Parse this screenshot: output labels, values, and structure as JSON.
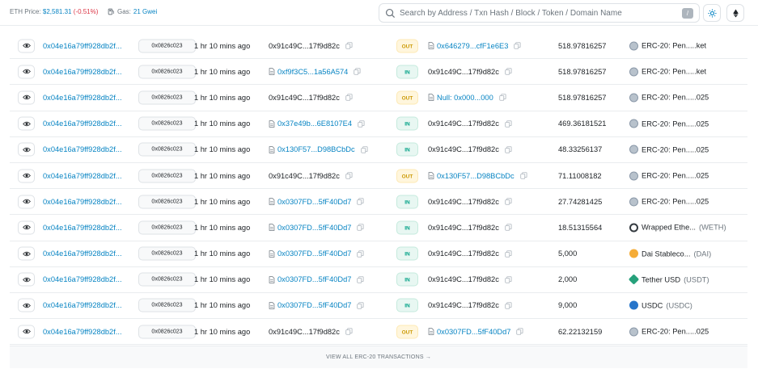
{
  "header": {
    "eth_price_label": "ETH Price: ",
    "eth_price_value": "$2,581.31",
    "eth_price_change": "(-0.51%)",
    "gas_label": "Gas: ",
    "gas_value": "21 Gwei",
    "search_placeholder": "Search by Address / Txn Hash / Block / Token / Domain Name",
    "search_shortcut": "/",
    "colors": {
      "link": "#0784c3",
      "negative": "#dc3545",
      "out": "#cc9a06",
      "in": "#00a186"
    }
  },
  "rows": [
    {
      "hash": "0x04e16a79ff928db2f...",
      "method": "0x0826c023",
      "age": "1 hr 10 mins ago",
      "from": "0x91c49C...17f9d82c",
      "from_link": false,
      "direction": "OUT",
      "to": "0x646279...cfF1e6E3",
      "to_link": true,
      "amount": "518.97816257",
      "token": "ERC-20: Pen.....ket",
      "token_sym": "",
      "token_icon": "generic-token-icon"
    },
    {
      "hash": "0x04e16a79ff928db2f...",
      "method": "0x0826c023",
      "age": "1 hr 10 mins ago",
      "from": "0xf9f3C5...1a56A574",
      "from_link": true,
      "direction": "IN",
      "to": "0x91c49C...17f9d82c",
      "to_link": false,
      "amount": "518.97816257",
      "token": "ERC-20: Pen.....ket",
      "token_sym": "",
      "token_icon": "generic-token-icon"
    },
    {
      "hash": "0x04e16a79ff928db2f...",
      "method": "0x0826c023",
      "age": "1 hr 10 mins ago",
      "from": "0x91c49C...17f9d82c",
      "from_link": false,
      "direction": "OUT",
      "to": "Null: 0x000...000",
      "to_link": true,
      "amount": "518.97816257",
      "token": "ERC-20: Pen.....025",
      "token_sym": "",
      "token_icon": "generic-token-icon"
    },
    {
      "hash": "0x04e16a79ff928db2f...",
      "method": "0x0826c023",
      "age": "1 hr 10 mins ago",
      "from": "0x37e49b...6E8107E4",
      "from_link": true,
      "direction": "IN",
      "to": "0x91c49C...17f9d82c",
      "to_link": false,
      "amount": "469.36181521",
      "token": "ERC-20: Pen.....025",
      "token_sym": "",
      "token_icon": "generic-token-icon"
    },
    {
      "hash": "0x04e16a79ff928db2f...",
      "method": "0x0826c023",
      "age": "1 hr 10 mins ago",
      "from": "0x130F57...D98BCbDc",
      "from_link": true,
      "direction": "IN",
      "to": "0x91c49C...17f9d82c",
      "to_link": false,
      "amount": "48.33256137",
      "token": "ERC-20: Pen.....025",
      "token_sym": "",
      "token_icon": "generic-token-icon"
    },
    {
      "hash": "0x04e16a79ff928db2f...",
      "method": "0x0826c023",
      "age": "1 hr 10 mins ago",
      "from": "0x91c49C...17f9d82c",
      "from_link": false,
      "direction": "OUT",
      "to": "0x130F57...D98BCbDc",
      "to_link": true,
      "amount": "71.11008182",
      "token": "ERC-20: Pen.....025",
      "token_sym": "",
      "token_icon": "generic-token-icon"
    },
    {
      "hash": "0x04e16a79ff928db2f...",
      "method": "0x0826c023",
      "age": "1 hr 10 mins ago",
      "from": "0x0307FD...5fF40Dd7",
      "from_link": true,
      "direction": "IN",
      "to": "0x91c49C...17f9d82c",
      "to_link": false,
      "amount": "27.74281425",
      "token": "ERC-20: Pen.....025",
      "token_sym": "",
      "token_icon": "generic-token-icon"
    },
    {
      "hash": "0x04e16a79ff928db2f...",
      "method": "0x0826c023",
      "age": "1 hr 10 mins ago",
      "from": "0x0307FD...5fF40Dd7",
      "from_link": true,
      "direction": "IN",
      "to": "0x91c49C...17f9d82c",
      "to_link": false,
      "amount": "18.51315564",
      "token": "Wrapped Ethe...",
      "token_sym": "(WETH)",
      "token_icon": "weth-icon"
    },
    {
      "hash": "0x04e16a79ff928db2f...",
      "method": "0x0826c023",
      "age": "1 hr 10 mins ago",
      "from": "0x0307FD...5fF40Dd7",
      "from_link": true,
      "direction": "IN",
      "to": "0x91c49C...17f9d82c",
      "to_link": false,
      "amount": "5,000",
      "token": "Dai Stableco...",
      "token_sym": "(DAI)",
      "token_icon": "dai-icon"
    },
    {
      "hash": "0x04e16a79ff928db2f...",
      "method": "0x0826c023",
      "age": "1 hr 10 mins ago",
      "from": "0x0307FD...5fF40Dd7",
      "from_link": true,
      "direction": "IN",
      "to": "0x91c49C...17f9d82c",
      "to_link": false,
      "amount": "2,000",
      "token": "Tether USD",
      "token_sym": "(USDT)",
      "token_icon": "usdt-icon"
    },
    {
      "hash": "0x04e16a79ff928db2f...",
      "method": "0x0826c023",
      "age": "1 hr 10 mins ago",
      "from": "0x0307FD...5fF40Dd7",
      "from_link": true,
      "direction": "IN",
      "to": "0x91c49C...17f9d82c",
      "to_link": false,
      "amount": "9,000",
      "token": "USDC",
      "token_sym": "(USDC)",
      "token_icon": "usdc-icon"
    },
    {
      "hash": "0x04e16a79ff928db2f...",
      "method": "0x0826c023",
      "age": "1 hr 10 mins ago",
      "from": "0x91c49C...17f9d82c",
      "from_link": false,
      "direction": "OUT",
      "to": "0x0307FD...5fF40Dd7",
      "to_link": true,
      "amount": "62.22132159",
      "token": "ERC-20: Pen.....025",
      "token_sym": "",
      "token_icon": "generic-token-icon"
    }
  ],
  "footer": {
    "label": "VIEW ALL ERC-20 TRANSACTIONS →"
  }
}
